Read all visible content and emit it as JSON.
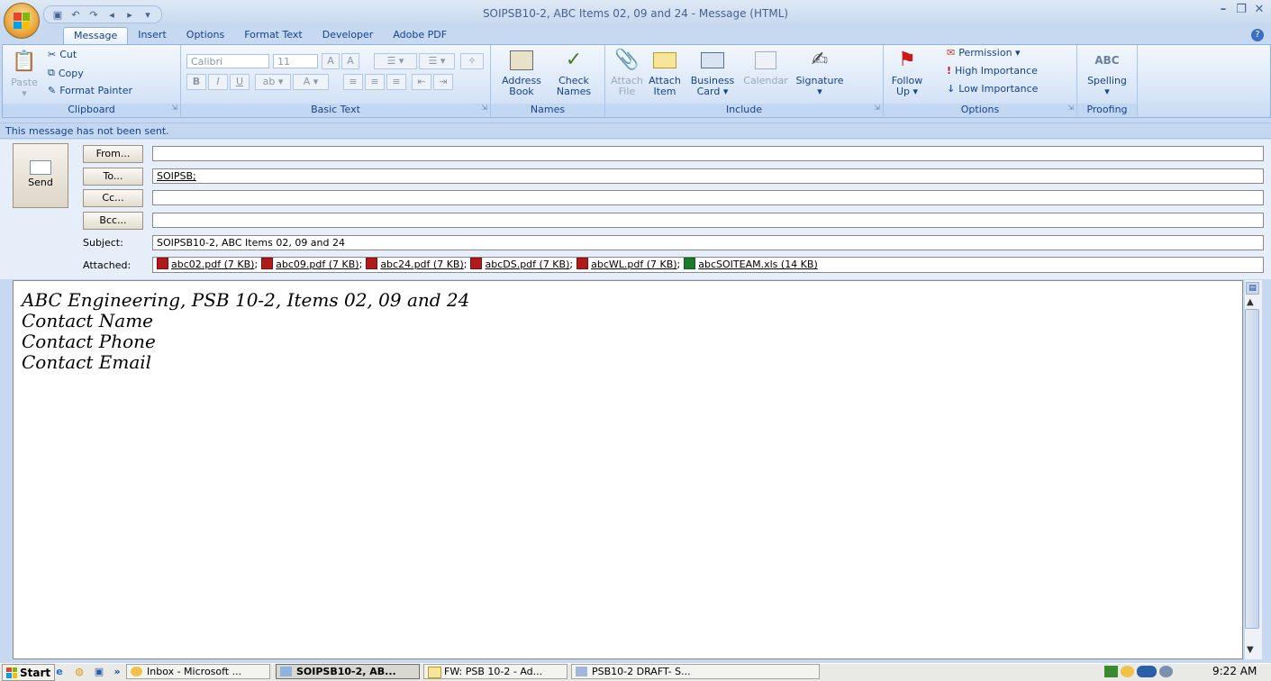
{
  "window": {
    "title": "SOIPSB10-2, ABC Items 02, 09 and 24 - Message (HTML)"
  },
  "tabs": [
    "Message",
    "Insert",
    "Options",
    "Format Text",
    "Developer",
    "Adobe PDF"
  ],
  "ribbon": {
    "clipboard": {
      "label": "Clipboard",
      "paste": "Paste",
      "cut": "Cut",
      "copy": "Copy",
      "format_painter": "Format Painter"
    },
    "basic_text": {
      "label": "Basic Text",
      "font": "Calibri",
      "size": "11",
      "bold": "B",
      "italic": "I",
      "underline": "U"
    },
    "names": {
      "label": "Names",
      "address_book_1": "Address",
      "address_book_2": "Book",
      "check_names_1": "Check",
      "check_names_2": "Names"
    },
    "include": {
      "label": "Include",
      "attach_file_1": "Attach",
      "attach_file_2": "File",
      "attach_item_1": "Attach",
      "attach_item_2": "Item",
      "business_card_1": "Business",
      "business_card_2": "Card ▾",
      "calendar": "Calendar",
      "signature": "Signature"
    },
    "options": {
      "label": "Options",
      "follow_up_1": "Follow",
      "follow_up_2": "Up ▾",
      "permission": "Permission ▾",
      "high_importance": "High Importance",
      "low_importance": "Low Importance"
    },
    "proofing": {
      "label": "Proofing",
      "spelling": "Spelling",
      "abc": "ABC"
    }
  },
  "infobar": {
    "text": "This message has not been sent."
  },
  "header": {
    "send": "Send",
    "from_btn": "From...",
    "to_btn": "To...",
    "cc_btn": "Cc...",
    "bcc_btn": "Bcc...",
    "from_value": "",
    "to_value": "SOIPSB;",
    "cc_value": "",
    "bcc_value": "",
    "subject_label": "Subject:",
    "subject_value": "SOIPSB10-2, ABC Items 02, 09 and 24",
    "attached_label": "Attached:",
    "attachments": [
      {
        "name": "abc02.pdf (7 KB)",
        "type": "pdf",
        "sep": ";"
      },
      {
        "name": "abc09.pdf (7 KB)",
        "type": "pdf",
        "sep": ";"
      },
      {
        "name": "abc24.pdf (7 KB)",
        "type": "pdf",
        "sep": ";"
      },
      {
        "name": "abcDS.pdf (7 KB)",
        "type": "pdf",
        "sep": ";"
      },
      {
        "name": "abcWL.pdf (7 KB)",
        "type": "pdf",
        "sep": ";"
      },
      {
        "name": "abcSOITEAM.xls (14 KB)",
        "type": "xls",
        "sep": ""
      }
    ]
  },
  "body": {
    "lines": [
      "ABC Engineering, PSB 10-2, Items 02, 09 and 24",
      "Contact Name",
      "Contact Phone",
      "Contact Email"
    ]
  },
  "taskbar": {
    "start": "Start",
    "chevron": "»",
    "items": [
      {
        "label": "Inbox - Microsoft ...",
        "active": false
      },
      {
        "label": "SOIPSB10-2, AB...",
        "active": true
      },
      {
        "label": "FW: PSB 10-2 - Ad...",
        "active": false
      },
      {
        "label": "PSB10-2 DRAFT- S...",
        "active": false
      }
    ],
    "clock": "9:22 AM"
  },
  "colors": {
    "ribbon_text": "#15428b",
    "ribbon_bg": "#dbe8f8",
    "pdf_icon": "#b01a1a",
    "xls_icon": "#1d7a2b"
  }
}
